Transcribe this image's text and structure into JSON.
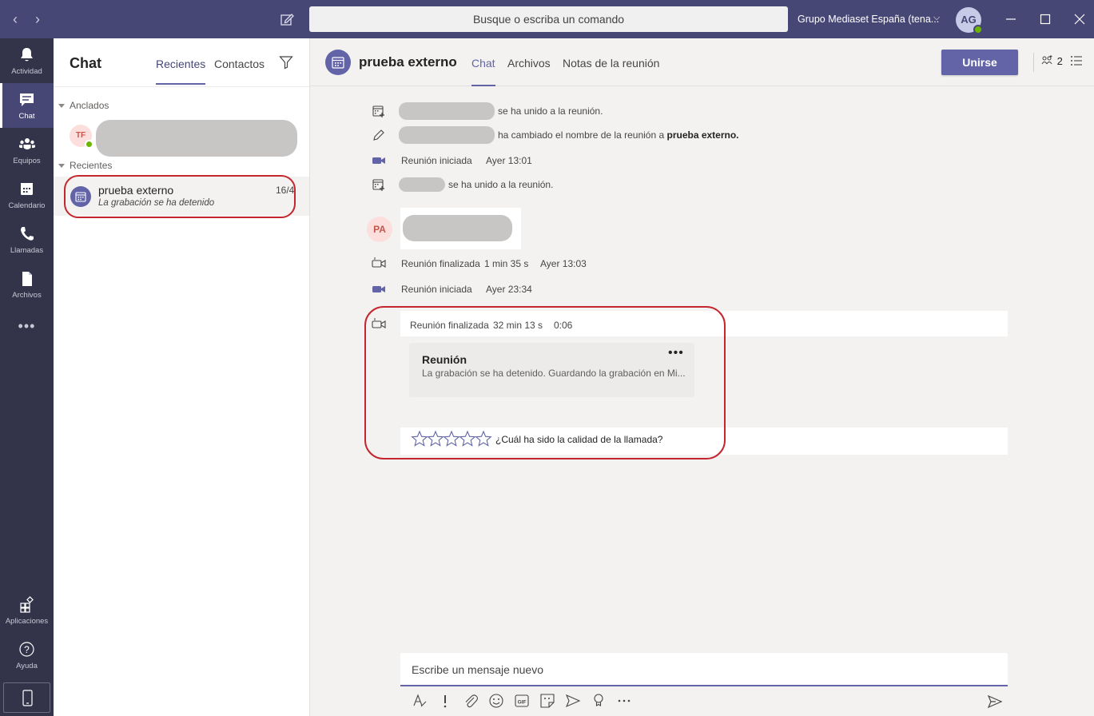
{
  "titlebar": {
    "search_placeholder": "Busque o escriba un comando",
    "tenant": "Grupo Mediaset España (tena...",
    "user_initials": "AG"
  },
  "rail": {
    "items": [
      {
        "label": "Actividad",
        "icon": "bell-icon"
      },
      {
        "label": "Chat",
        "icon": "chat-icon"
      },
      {
        "label": "Equipos",
        "icon": "teams-icon"
      },
      {
        "label": "Calendario",
        "icon": "calendar-icon"
      },
      {
        "label": "Llamadas",
        "icon": "phone-icon"
      },
      {
        "label": "Archivos",
        "icon": "file-icon"
      }
    ],
    "more": "•••",
    "bottom": [
      {
        "label": "Aplicaciones",
        "icon": "apps-icon"
      },
      {
        "label": "Ayuda",
        "icon": "help-icon"
      }
    ]
  },
  "chatlist": {
    "title": "Chat",
    "tabs": [
      "Recientes",
      "Contactos"
    ],
    "pinned_header": "Anclados",
    "pinned_initials": "TF",
    "recent_header": "Recientes",
    "recent_item": {
      "name": "prueba externo",
      "date": "16/4",
      "preview": "La grabación se ha detenido"
    }
  },
  "main": {
    "title": "prueba externo",
    "tabs": [
      "Chat",
      "Archivos",
      "Notas de la reunión"
    ],
    "join_label": "Unirse",
    "participants": "2"
  },
  "messages": {
    "m1": "se ha unido a la reunión.",
    "m2_pre": "ha cambiado el nombre de la reunión a",
    "m2_name": "prueba externo.",
    "m3_label": "Reunión iniciada",
    "m3_time": "Ayer 13:01",
    "m4": "se ha unido a la reunión.",
    "pa_initials": "PA",
    "m5_label": "Reunión finalizada",
    "m5_duration": "1 min 35 s",
    "m5_time": "Ayer 13:03",
    "m6_label": "Reunión iniciada",
    "m6_time": "Ayer 23:34",
    "m7_label": "Reunión finalizada",
    "m7_duration": "32 min 13 s",
    "m7_time": "0:06",
    "rec_title": "Reunión",
    "rec_desc": "La grabación se ha detenido. Guardando la grabación en Mi...",
    "rec_more": "•••",
    "rating_question": "¿Cuál ha sido la calidad de la llamada?",
    "rating_stars": 5
  },
  "compose": {
    "placeholder": "Escribe un mensaje nuevo"
  },
  "colors": {
    "brand": "#6264a7",
    "titlebar": "#464775",
    "rail": "#33344a",
    "highlight": "#c4262e"
  }
}
